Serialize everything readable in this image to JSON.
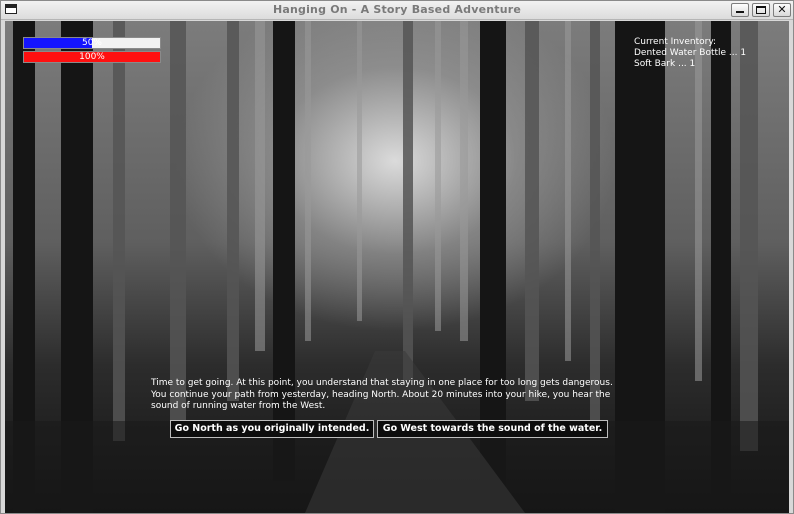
{
  "window": {
    "title": "Hanging On - A Story Based Adventure",
    "controls": [
      "minimize-icon",
      "maximize-icon",
      "close-icon"
    ],
    "close_glyph": "✕"
  },
  "hud": {
    "energy_bar": {
      "label": "50%",
      "value": 0.5,
      "color": "#1414ff"
    },
    "health_bar": {
      "label": "100%",
      "value": 1.0,
      "color": "#ff1010"
    }
  },
  "inventory": {
    "header": "Current Inventory:",
    "items": [
      "Dented Water Bottle ... 1",
      "Soft Bark ... 1"
    ]
  },
  "story": {
    "text": "Time to get going. At this point, you understand that staying in one place for too long gets dangerous. You continue your path from yesterday, heading North. About 20 minutes into your hike, you hear the sound of running water from the West."
  },
  "choices": [
    {
      "label": "Go North as you originally intended."
    },
    {
      "label": "Go West towards the sound of the water."
    }
  ]
}
